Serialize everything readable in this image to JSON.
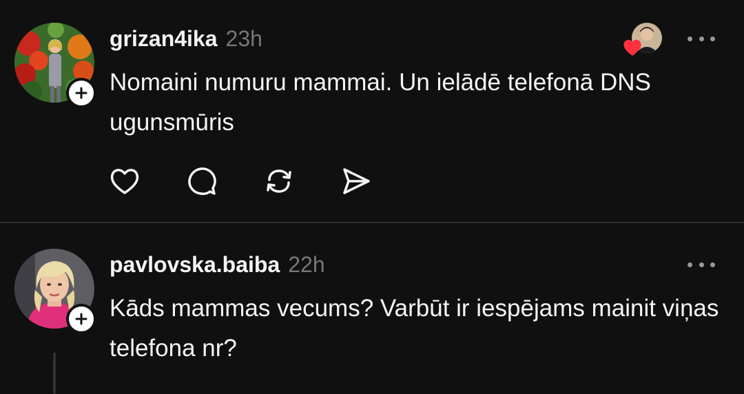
{
  "posts": [
    {
      "username": "grizan4ika",
      "time": "23h",
      "text": "Nomaini numuru mammai. Un ielādē telefonā DNS ugunsmūris",
      "avatar_icon": "profile-photo-woman-flowers",
      "liked_by_icon": "liker-avatar-man",
      "actions": [
        "heart-icon",
        "comment-icon",
        "repost-icon",
        "share-icon"
      ]
    },
    {
      "username": "pavlovska.baiba",
      "time": "22h",
      "text": "Kāds mammas vecums? Varbūt ir iespējams mainit viņas telefona nr?",
      "avatar_icon": "profile-photo-blonde-woman"
    }
  ],
  "colors": {
    "background": "#101010",
    "text": "#f3f5f7",
    "muted": "#777777",
    "heart_red": "#ff3040"
  }
}
